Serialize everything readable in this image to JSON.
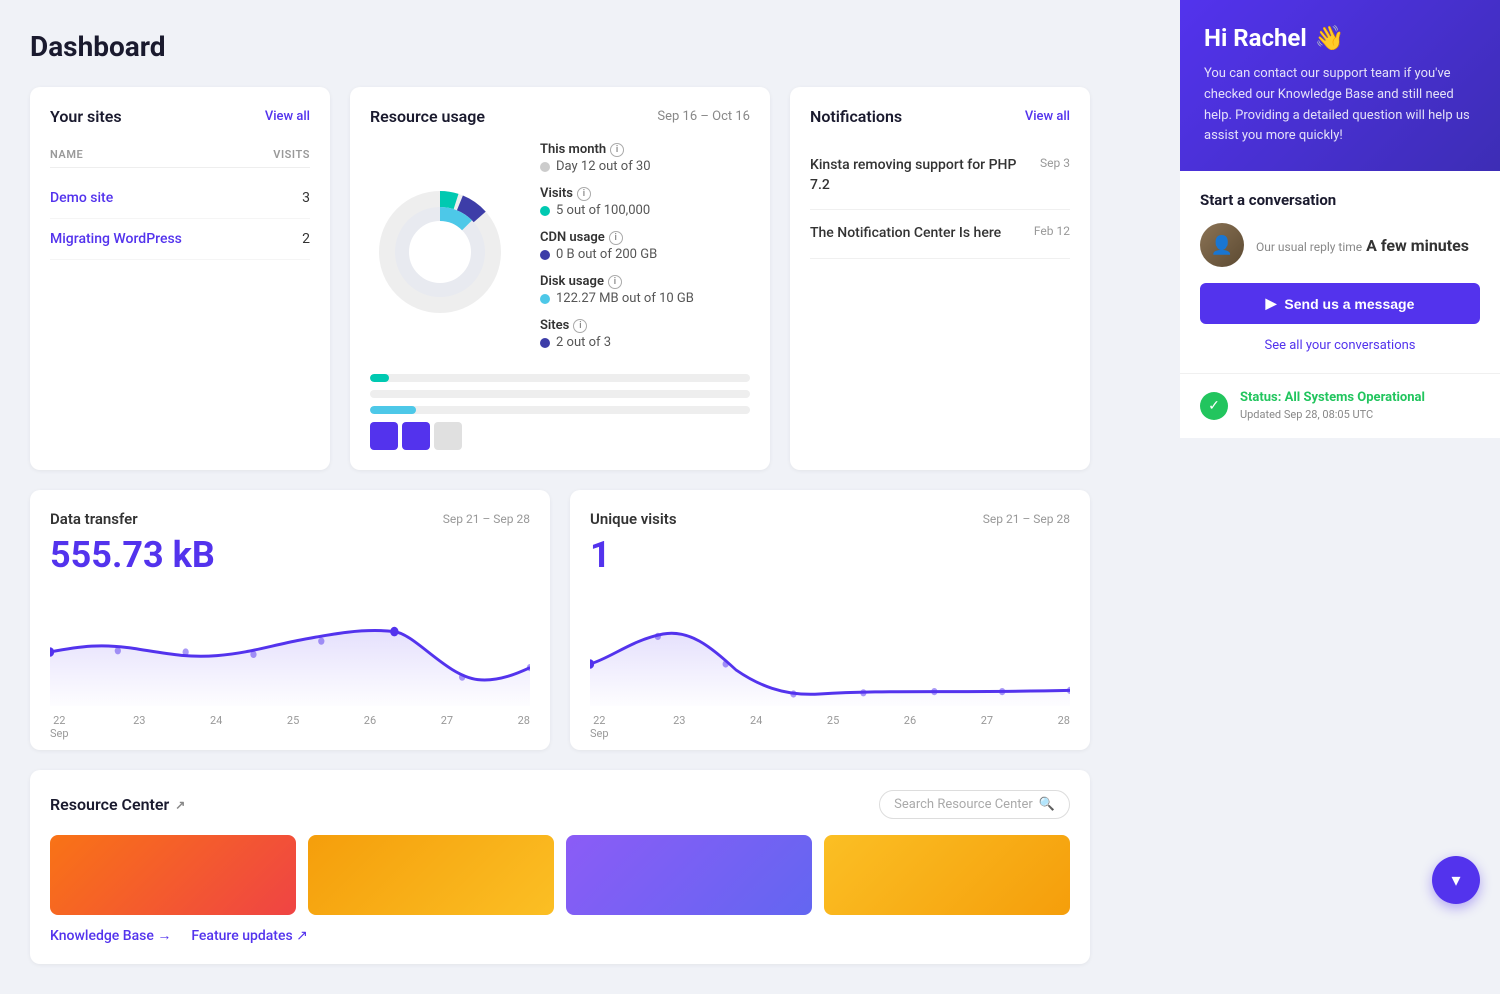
{
  "page": {
    "title": "Dashboard"
  },
  "sites_card": {
    "title": "Your sites",
    "view_all_label": "View all",
    "col_name": "NAME",
    "col_visits": "VISITS",
    "sites": [
      {
        "name": "Demo site",
        "visits": 3
      },
      {
        "name": "Migrating WordPress",
        "visits": 2
      }
    ]
  },
  "resource_card": {
    "title": "Resource usage",
    "date_range": "Sep 16 – Oct 16",
    "stats": [
      {
        "label": "This month",
        "value": "Day 12 out of 30",
        "dot": "gray"
      },
      {
        "label": "Visits",
        "value": "5 out of 100,000",
        "dot": "teal"
      },
      {
        "label": "CDN usage",
        "value": "0 B out of 200 GB",
        "dot": "navy"
      },
      {
        "label": "Disk usage",
        "value": "122.27 MB out of 10 GB",
        "dot": "cyan"
      },
      {
        "label": "Sites",
        "value": "2 out of 3",
        "dot": "navy"
      }
    ]
  },
  "notifications_card": {
    "title": "Notifications",
    "view_all_label": "View all",
    "items": [
      {
        "text": "Kinsta removing support for PHP 7.2",
        "date": "Sep 3"
      },
      {
        "text": "The Notification Center Is here",
        "date": "Feb 12"
      }
    ]
  },
  "data_transfer_card": {
    "title": "Data transfer",
    "date_range": "Sep 21 – Sep 28",
    "value": "555.73 kB",
    "labels": [
      "22\nSep",
      "23",
      "24",
      "25",
      "26",
      "27",
      "28"
    ]
  },
  "unique_visits_card": {
    "title": "Unique visits",
    "date_range": "Sep 21 – Sep 28",
    "value": "1",
    "labels": [
      "22\nSep",
      "23",
      "24",
      "25",
      "26",
      "27",
      "28"
    ]
  },
  "resource_center": {
    "title": "Resource Center",
    "search_placeholder": "Search Resource Center",
    "links": [
      {
        "label": "Knowledge Base →"
      },
      {
        "label": "Feature updates ↗"
      }
    ]
  },
  "support_panel": {
    "greeting": "Hi Rachel",
    "wave": "👋",
    "description": "You can contact our support team if you've checked our Knowledge Base and still need help. Providing a detailed question will help us assist you more quickly!",
    "conversation_title": "Start a conversation",
    "reply_time_label": "Our usual reply time",
    "reply_time_value": "A few minutes",
    "send_btn_label": "Send us a message",
    "see_all_label": "See all your conversations",
    "status_label": "Status: All Systems Operational",
    "status_updated": "Updated Sep 28, 08:05 UTC"
  }
}
